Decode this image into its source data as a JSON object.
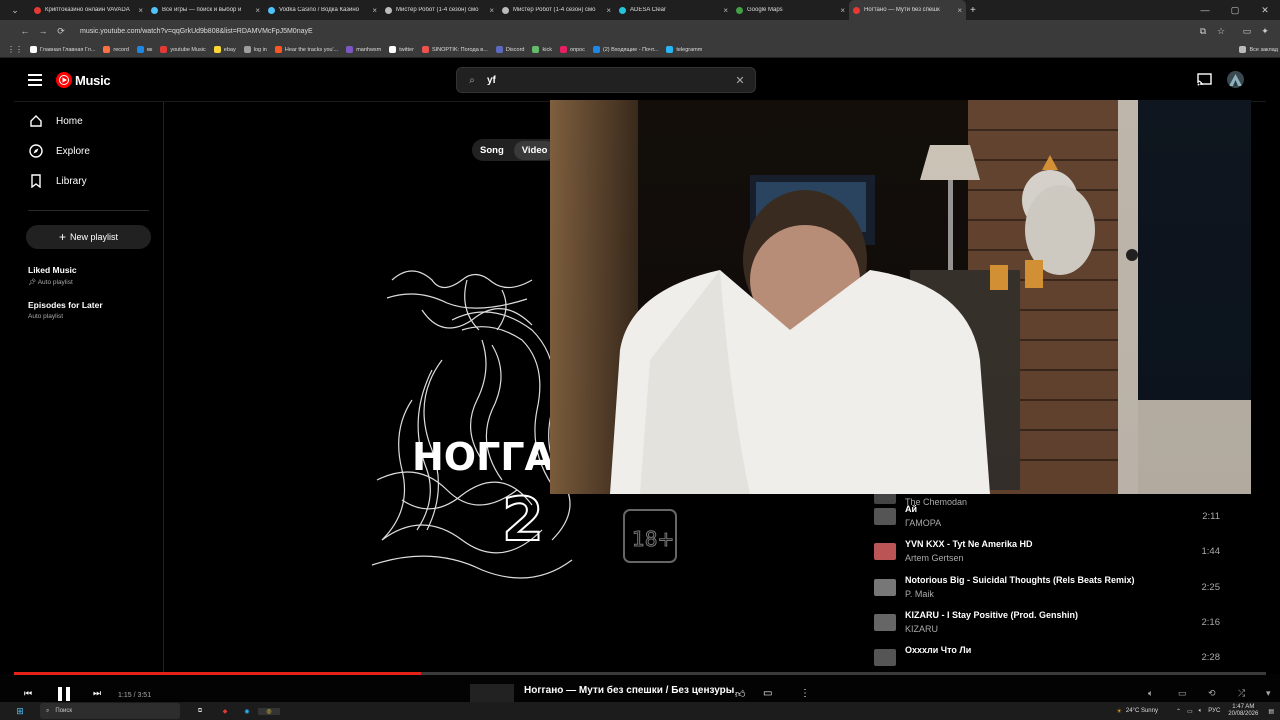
{
  "browser": {
    "tabs": [
      {
        "title": "Криптоказино онлайн VAVADA",
        "color": "#e53935"
      },
      {
        "title": "Все игры — поиск и выбор и",
        "color": "#4fc3f7"
      },
      {
        "title": "Vodka Casino / Водка Казино",
        "color": "#4fc3f7"
      },
      {
        "title": "Мистер Робот (1-4 сезон) смо",
        "color": "#bbbbbb"
      },
      {
        "title": "Мистер Робот (1-4 сезон) смо",
        "color": "#bbbbbb"
      },
      {
        "title": "ADESA Clear",
        "color": "#26c6da"
      },
      {
        "title": "Google Maps",
        "color": "#43a047"
      },
      {
        "title": "Ногтано — Мути без спешк",
        "color": "#e53935"
      }
    ],
    "url": "music.youtube.com/watch?v=qqGrkUd9b808&list=RDAMVMcFpJ5M0nayE",
    "bookmarks": [
      {
        "label": "Главная Главная Гл...",
        "color": "#ffffff"
      },
      {
        "label": "record",
        "color": "#ff7043"
      },
      {
        "label": "вк",
        "color": "#1e88e5"
      },
      {
        "label": "youtube Music",
        "color": "#e53935"
      },
      {
        "label": "ebay",
        "color": "#fdd835"
      },
      {
        "label": "log in",
        "color": "#9e9e9e"
      },
      {
        "label": "Hear the tracks you'...",
        "color": "#ff5722"
      },
      {
        "label": "manhwsm",
        "color": "#7e57c2"
      },
      {
        "label": "twitter",
        "color": "#ffffff"
      },
      {
        "label": "SINOPTIK: Погода в...",
        "color": "#ef5350"
      },
      {
        "label": "Discord",
        "color": "#5c6bc0"
      },
      {
        "label": "kick",
        "color": "#66bb6a"
      },
      {
        "label": "опрос",
        "color": "#e91e63"
      },
      {
        "label": "(2) Входящие - Почт...",
        "color": "#1e88e5"
      },
      {
        "label": "telegramm",
        "color": "#29b6f6"
      }
    ],
    "all_bookmarks": "Все заклад"
  },
  "app": {
    "logo_text": "Music",
    "search_value": "yf",
    "nav": [
      {
        "label": "Home",
        "icon": "home-icon"
      },
      {
        "label": "Explore",
        "icon": "explore-icon"
      },
      {
        "label": "Library",
        "icon": "library-icon"
      }
    ],
    "new_playlist": "New playlist",
    "playlists": [
      {
        "title": "Liked Music",
        "sub": "Auto playlist"
      },
      {
        "title": "Episodes for Later",
        "sub": "Auto playlist"
      }
    ],
    "toggle": {
      "song": "Song",
      "video": "Video"
    },
    "album_art_text": "ноггано 2",
    "queue": [
      {
        "title": "",
        "artist": "The Chemodan",
        "duration": "",
        "color": "#444"
      },
      {
        "title": "Ай",
        "artist": "ГАМОРА",
        "duration": "2:11",
        "color": "#555"
      },
      {
        "title": "YVN KXX - Tyt Ne Amerika HD",
        "artist": "Artem Gertsen",
        "duration": "1:44",
        "color": "#b55"
      },
      {
        "title": "Notorious Big - Suicidal Thoughts (Rels Beats Remix)",
        "artist": "P. Maik",
        "duration": "2:25",
        "color": "#777"
      },
      {
        "title": "KIZARU - I Stay Positive (Prod. Genshin)",
        "artist": "KIZARU",
        "duration": "2:16",
        "color": "#666"
      },
      {
        "title": "Охххли Что Ли",
        "artist": "",
        "duration": "2:28",
        "color": "#555"
      }
    ]
  },
  "player": {
    "time": "1:15 / 3:51",
    "progress": 0.325,
    "now_playing": "Ноггано — Мути без спешки / Без цензуры"
  },
  "taskbar": {
    "search_placeholder": "Поиск",
    "weather": "24°C  Sunny",
    "lang": "РУС",
    "time": "1:47 AM",
    "date": "20/08/2026"
  }
}
